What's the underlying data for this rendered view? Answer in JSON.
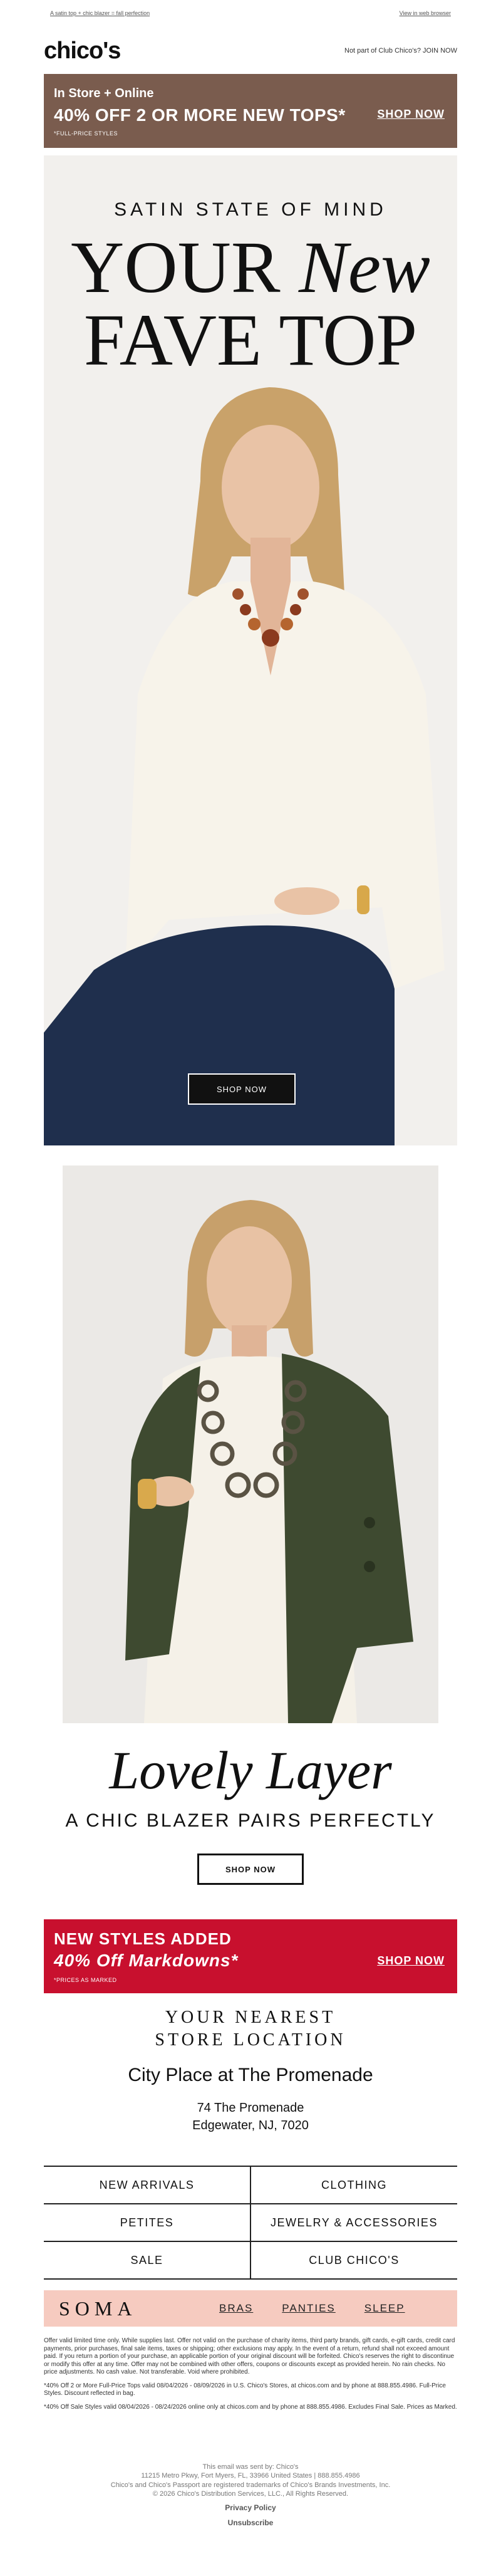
{
  "preheader": {
    "left_text": "A satin top + chic blazer = fall perfection",
    "right_text": "View in web browser"
  },
  "header": {
    "logo": "chico's",
    "join_text": "Not part of Club Chico's? JOIN NOW"
  },
  "promo_top": {
    "line1": "In Store + Online",
    "line2": "40% OFF 2 OR MORE NEW TOPS*",
    "line3": "*FULL-PRICE STYLES",
    "cta": "SHOP NOW"
  },
  "hero": {
    "eyebrow": "SATIN STATE OF MIND",
    "title_part1": "YOUR ",
    "title_italic": "New",
    "title_line2": "FAVE TOP",
    "cta": "SHOP NOW"
  },
  "feature": {
    "title": "Lovely Layer",
    "subtitle": "A CHIC BLAZER PAIRS PERFECTLY",
    "cta": "SHOP NOW"
  },
  "promo_red": {
    "line1": "NEW STYLES ADDED",
    "line2": "40% Off Markdowns*",
    "line3": "*PRICES AS MARKED",
    "cta": "SHOP NOW"
  },
  "store": {
    "heading_line1": "YOUR NEAREST",
    "heading_line2": "STORE LOCATION",
    "name": "City Place at The Promenade",
    "address_line1": "74 The Promenade",
    "address_line2": "Edgewater, NJ, 7020"
  },
  "nav": [
    [
      "NEW ARRIVALS",
      "CLOTHING"
    ],
    [
      "PETITES",
      "JEWELRY & ACCESSORIES"
    ],
    [
      "SALE",
      "CLUB CHICO'S"
    ]
  ],
  "soma": {
    "logo": "SOMA",
    "links": [
      "BRAS",
      "PANTIES",
      "SLEEP"
    ]
  },
  "legal": [
    "Offer valid limited time only. While supplies last. Offer not valid on the purchase of charity items, third party brands, gift cards, e-gift cards, credit card payments, prior purchases, final sale items, taxes or shipping; other exclusions may apply. In the event of a return, refund shall not exceed amount paid. If you return a portion of your purchase, an applicable portion of your original discount will be forfeited. Chico's reserves the right to discontinue or modify this offer at any time. Offer may not be combined with other offers, coupons or discounts except as provided herein. No rain checks. No price adjustments. No cash value. Not transferable. Void where prohibited.",
    "*40% Off 2 or More Full-Price Tops valid 08/04/2026 - 08/09/2026 in U.S. Chico's Stores, at chicos.com and by phone at 888.855.4986. Full-Price Styles. Discount reflected in bag.",
    "*40% Off Sale Styles valid 08/04/2026 - 08/24/2026 online only at chicos.com and by phone at 888.855.4986. Excludes Final Sale. Prices as Marked."
  ],
  "footer": {
    "line1": "This email was sent by: Chico's",
    "line2": "11215 Metro Pkwy, Fort Myers, FL, 33966 United States | 888.855.4986",
    "line3": "Chico's and Chico's Passport are registered trademarks of Chico's Brands Investments, Inc.",
    "line4": "© 2026 Chico's Distribution Services, LLC., All Rights Reserved.",
    "privacy": "Privacy Policy",
    "unsubscribe": "Unsubscribe"
  },
  "colors": {
    "promo_brown": "#7a5c4e",
    "promo_red": "#c8102e",
    "soma_pink": "#f6cbc0"
  }
}
